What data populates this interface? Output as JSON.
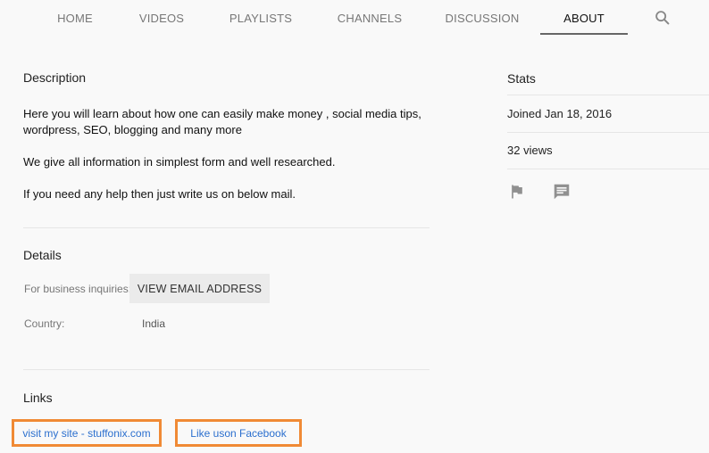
{
  "tabs": [
    {
      "label": "HOME"
    },
    {
      "label": "VIDEOS"
    },
    {
      "label": "PLAYLISTS"
    },
    {
      "label": "CHANNELS"
    },
    {
      "label": "DISCUSSION"
    },
    {
      "label": "ABOUT",
      "active": true
    }
  ],
  "description": {
    "heading": "Description",
    "para1_line1": "Here you will learn about how one can easily make money , social media tips,",
    "para1_line2": "wordpress, SEO, blogging and many more",
    "para2": "We give all information in simplest form and well researched.",
    "para3": "If you need any help then just write us on below mail."
  },
  "details": {
    "heading": "Details",
    "business_label": "For business inquiries:",
    "email_button": "VIEW EMAIL ADDRESS",
    "country_label": "Country:",
    "country_value": "India"
  },
  "links": {
    "heading": "Links",
    "items": [
      {
        "label": "visit my site - stuffonix.com"
      },
      {
        "label": "Like uson Facebook"
      }
    ]
  },
  "stats": {
    "heading": "Stats",
    "joined": "Joined Jan 18, 2016",
    "views": "32 views"
  },
  "colors": {
    "link": "#2b6fce",
    "highlight_border": "#f08a35"
  },
  "icons": [
    "search-icon",
    "flag-icon",
    "message-icon"
  ]
}
